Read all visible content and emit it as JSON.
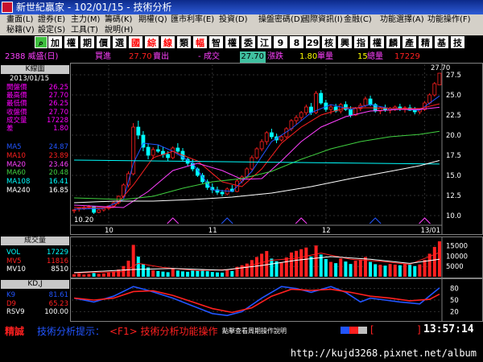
{
  "window": {
    "title": "新世紀贏家 - 102/01/15 - 技術分析"
  },
  "menu": {
    "row1": [
      "畫面(L)",
      "證券(E)",
      "主力(M)",
      "籌碼(K)",
      "期權(Q)",
      "匯市利率(E)",
      "投資(D)",
      "操盤密碼(D)",
      "國際資訊(I)",
      "金融(C)",
      "功能選擇(A)",
      "功能操作(F)"
    ],
    "row2": [
      "秘籍(V)",
      "設定(S)",
      "工具(T)",
      "說明(H)"
    ]
  },
  "toolbar": {
    "buttons": [
      {
        "label": "⌕",
        "icon": "search-icon",
        "fg": "#000000",
        "bg": "#40c040"
      },
      {
        "label": "加",
        "fg": "#000000",
        "bg": "#ffffff"
      },
      {
        "label": "權",
        "fg": "#000000",
        "bg": "#ffffff"
      },
      {
        "label": "期",
        "fg": "#000000",
        "bg": "#ffffff"
      },
      {
        "label": "價",
        "fg": "#000000",
        "bg": "#ffffff"
      },
      {
        "label": "選",
        "fg": "#000000",
        "bg": "#ffffff"
      },
      {
        "label": "國",
        "fg": "#ff0000",
        "bg": "#ffffff"
      },
      {
        "label": "綜",
        "fg": "#ff0000",
        "bg": "#ffffff"
      },
      {
        "label": "線",
        "fg": "#ff0000",
        "bg": "#ffffff"
      },
      {
        "label": "類",
        "fg": "#000000",
        "bg": "#ffffff"
      },
      {
        "label": "幅",
        "fg": "#ff0000",
        "bg": "#ffffff"
      },
      {
        "label": "智",
        "fg": "#000000",
        "bg": "#ffffff"
      },
      {
        "label": "權",
        "fg": "#000000",
        "bg": "#ffffff"
      },
      {
        "label": "委",
        "fg": "#000000",
        "bg": "#ffffff"
      },
      {
        "label": "江",
        "fg": "#000000",
        "bg": "#ffffff"
      },
      {
        "label": "9",
        "fg": "#000000",
        "bg": "#ffffff"
      },
      {
        "label": "8",
        "fg": "#000000",
        "bg": "#ffffff"
      },
      {
        "label": "29",
        "fg": "#000000",
        "bg": "#ffffff"
      },
      {
        "label": "核",
        "fg": "#000000",
        "bg": "#ffffff"
      },
      {
        "label": "興",
        "fg": "#000000",
        "bg": "#ffffff"
      },
      {
        "label": "指",
        "fg": "#000000",
        "bg": "#ffffff"
      },
      {
        "label": "權",
        "fg": "#000000",
        "bg": "#ffffff"
      },
      {
        "label": "麟",
        "fg": "#000000",
        "bg": "#ffffff"
      },
      {
        "label": "產",
        "fg": "#000000",
        "bg": "#ffffff"
      },
      {
        "label": "精",
        "fg": "#000000",
        "bg": "#ffffff"
      },
      {
        "label": "基",
        "fg": "#000000",
        "bg": "#ffffff"
      },
      {
        "label": "技",
        "fg": "#000000",
        "bg": "#ffffff"
      }
    ]
  },
  "quote": {
    "symbol": "2388 威盛(日)",
    "bid_label": "買進",
    "bid": "27.70",
    "ask_label": "賣出",
    "change": "-",
    "trade_label": "成交",
    "trade_price": "27.70",
    "change_label": "漲跌",
    "tick_volume": "1.80",
    "tick_label": "單量",
    "total_tick": "15",
    "total_label": "總量",
    "total_volume": "17229"
  },
  "kline_panel": {
    "title": "K線圖",
    "date": "2013/01/15",
    "fields": [
      {
        "label": "開盤價",
        "value": "26.25",
        "color": "#ff00ff"
      },
      {
        "label": "最高價",
        "value": "27.70",
        "color": "#ff00ff"
      },
      {
        "label": "最低價",
        "value": "26.25",
        "color": "#ff00ff"
      },
      {
        "label": "收盤價",
        "value": "27.70",
        "color": "#ff00ff"
      },
      {
        "label": "成交量",
        "value": "17228",
        "color": "#ff00ff"
      },
      {
        "label": "差",
        "value": "1.80",
        "color": "#ff00ff"
      }
    ],
    "ma": [
      {
        "label": "MA5",
        "value": "24.87",
        "color": "#2255ff"
      },
      {
        "label": "MA10",
        "value": "23.89",
        "color": "#ff2020"
      },
      {
        "label": "MA20",
        "value": "23.46",
        "color": "#ff40ff"
      },
      {
        "label": "MA60",
        "value": "20.48",
        "color": "#40d040"
      },
      {
        "label": "MA108",
        "value": "16.41",
        "color": "#00ffff"
      },
      {
        "label": "MA240",
        "value": "16.85",
        "color": "#ffffff"
      }
    ]
  },
  "volume_panel": {
    "title": "成交量",
    "fields": [
      {
        "label": "VOL",
        "value": "17229",
        "color": "#00ffff"
      },
      {
        "label": "MV5",
        "value": "11816",
        "color": "#ff2020"
      },
      {
        "label": "MV10",
        "value": "8510",
        "color": "#ffffff"
      }
    ]
  },
  "kd_panel": {
    "title": "KD,J",
    "fields": [
      {
        "label": "K9",
        "value": "81.61",
        "color": "#2255ff"
      },
      {
        "label": "D9",
        "value": "65.23",
        "color": "#ff2020"
      },
      {
        "label": "RSV9",
        "value": "100.00",
        "color": "#ffffff"
      }
    ]
  },
  "bottom": {
    "mode": "精誠",
    "hint_label": "技術分析提示：",
    "hint_text": "<F1> 技術分析功能操作",
    "hint_overlay": "點擊查看周期操作說明",
    "bracket": "[",
    "bracket_close": "]",
    "time": "13:57:14"
  },
  "watermark": "http://kujd3268.pixnet.net/album",
  "colors": {
    "up": "#ff2020",
    "down": "#00ffff",
    "grid": "#404040"
  },
  "chart_data": {
    "type": "candlestick",
    "price_axis": {
      "ticks": [
        10.0,
        12.5,
        15.0,
        17.5,
        20.0,
        22.5,
        25.0,
        27.5
      ],
      "ylim": [
        9,
        28.8
      ]
    },
    "x_labels": [
      "10",
      "11",
      "12",
      "13/01"
    ],
    "annotations": {
      "high": "27.70",
      "low": "10.20"
    },
    "candles": [
      [
        10.6,
        10.8,
        10.3,
        10.7
      ],
      [
        10.8,
        11.0,
        10.5,
        10.9
      ],
      [
        10.9,
        11.2,
        10.7,
        11.0
      ],
      [
        11.0,
        11.3,
        10.8,
        11.1
      ],
      [
        11.1,
        11.2,
        10.2,
        10.4
      ],
      [
        10.4,
        10.8,
        10.3,
        10.7
      ],
      [
        10.7,
        11.0,
        10.5,
        10.9
      ],
      [
        10.9,
        11.3,
        10.7,
        11.2
      ],
      [
        11.2,
        11.8,
        11.0,
        11.6
      ],
      [
        11.6,
        12.5,
        11.4,
        12.4
      ],
      [
        12.4,
        14.0,
        12.2,
        13.8
      ],
      [
        13.8,
        15.5,
        13.5,
        15.2
      ],
      [
        15.2,
        21.5,
        15.0,
        21.0
      ],
      [
        21.0,
        21.8,
        19.5,
        20.0
      ],
      [
        20.0,
        20.5,
        18.0,
        18.5
      ],
      [
        18.5,
        19.0,
        17.0,
        17.5
      ],
      [
        17.5,
        18.5,
        17.0,
        18.2
      ],
      [
        18.2,
        18.8,
        17.8,
        18.0
      ],
      [
        18.0,
        18.5,
        17.2,
        17.6
      ],
      [
        17.6,
        18.0,
        16.8,
        17.2
      ],
      [
        17.2,
        18.6,
        17.0,
        18.4
      ],
      [
        18.4,
        19.0,
        17.8,
        18.0
      ],
      [
        18.0,
        18.4,
        16.8,
        17.0
      ],
      [
        17.0,
        17.2,
        16.2,
        16.5
      ],
      [
        16.5,
        17.0,
        15.5,
        15.8
      ],
      [
        15.8,
        16.0,
        14.8,
        15.0
      ],
      [
        15.0,
        15.3,
        14.0,
        14.2
      ],
      [
        14.2,
        14.5,
        13.2,
        13.5
      ],
      [
        13.5,
        14.0,
        12.8,
        13.2
      ],
      [
        13.2,
        13.6,
        12.6,
        12.9
      ],
      [
        12.9,
        13.2,
        12.4,
        12.7
      ],
      [
        12.7,
        13.5,
        12.5,
        13.3
      ],
      [
        13.3,
        13.8,
        12.9,
        13.0
      ],
      [
        13.0,
        14.5,
        12.9,
        14.3
      ],
      [
        14.3,
        15.0,
        14.0,
        14.8
      ],
      [
        14.8,
        16.0,
        14.5,
        15.8
      ],
      [
        15.8,
        17.5,
        15.6,
        17.2
      ],
      [
        17.2,
        18.5,
        17.0,
        18.3
      ],
      [
        18.3,
        19.5,
        18.0,
        19.2
      ],
      [
        19.2,
        20.5,
        18.8,
        20.3
      ],
      [
        20.3,
        20.8,
        19.5,
        19.8
      ],
      [
        19.8,
        20.2,
        19.0,
        19.4
      ],
      [
        19.4,
        20.0,
        19.2,
        19.8
      ],
      [
        19.8,
        21.0,
        19.6,
        20.8
      ],
      [
        20.8,
        22.0,
        20.5,
        21.8
      ],
      [
        21.8,
        22.5,
        21.3,
        22.2
      ],
      [
        22.2,
        23.0,
        21.8,
        22.8
      ],
      [
        22.8,
        23.8,
        22.5,
        23.5
      ],
      [
        23.5,
        24.0,
        22.5,
        22.8
      ],
      [
        22.8,
        25.5,
        22.6,
        25.2
      ],
      [
        25.2,
        25.6,
        23.8,
        24.0
      ],
      [
        24.0,
        24.4,
        22.9,
        23.2
      ],
      [
        23.2,
        23.8,
        22.6,
        23.5
      ],
      [
        23.5,
        23.9,
        22.8,
        23.0
      ],
      [
        23.0,
        24.0,
        22.7,
        23.8
      ],
      [
        23.8,
        24.2,
        23.0,
        23.2
      ],
      [
        23.2,
        23.6,
        22.2,
        22.5
      ],
      [
        22.5,
        23.5,
        22.4,
        23.3
      ],
      [
        23.3,
        24.0,
        23.0,
        23.7
      ],
      [
        23.7,
        24.8,
        23.5,
        24.5
      ],
      [
        24.5,
        24.9,
        23.6,
        23.8
      ],
      [
        23.8,
        24.0,
        22.8,
        23.0
      ],
      [
        23.0,
        23.6,
        22.6,
        23.4
      ],
      [
        23.4,
        23.8,
        22.9,
        23.1
      ],
      [
        23.1,
        23.5,
        22.7,
        23.3
      ],
      [
        23.3,
        23.7,
        23.0,
        23.5
      ],
      [
        23.5,
        23.9,
        23.0,
        23.2
      ],
      [
        23.2,
        23.6,
        22.8,
        23.4
      ],
      [
        23.4,
        23.8,
        23.0,
        23.1
      ],
      [
        23.1,
        23.5,
        22.6,
        22.9
      ],
      [
        22.9,
        23.3,
        22.6,
        23.2
      ],
      [
        23.2,
        24.2,
        23.0,
        24.0
      ],
      [
        24.0,
        25.2,
        23.8,
        25.0
      ],
      [
        25.0,
        26.6,
        24.8,
        26.4
      ],
      [
        26.25,
        27.7,
        26.25,
        27.7
      ]
    ],
    "ma_series": {
      "MA5": [
        [
          0,
          10.8
        ],
        [
          6,
          10.9
        ],
        [
          10,
          12.0
        ],
        [
          12,
          16.5
        ],
        [
          14,
          19.0
        ],
        [
          17,
          18.8
        ],
        [
          20,
          18.0
        ],
        [
          24,
          16.5
        ],
        [
          28,
          13.2
        ],
        [
          32,
          13.0
        ],
        [
          36,
          15.5
        ],
        [
          40,
          19.2
        ],
        [
          44,
          20.8
        ],
        [
          48,
          22.8
        ],
        [
          52,
          23.8
        ],
        [
          56,
          23.2
        ],
        [
          60,
          23.8
        ],
        [
          64,
          23.3
        ],
        [
          70,
          23.1
        ],
        [
          74,
          24.87
        ]
      ],
      "MA10": [
        [
          0,
          11.0
        ],
        [
          8,
          11.0
        ],
        [
          12,
          13.8
        ],
        [
          16,
          17.2
        ],
        [
          20,
          18.0
        ],
        [
          25,
          16.8
        ],
        [
          30,
          14.2
        ],
        [
          34,
          13.6
        ],
        [
          38,
          15.8
        ],
        [
          42,
          19.0
        ],
        [
          46,
          21.0
        ],
        [
          50,
          22.5
        ],
        [
          55,
          23.4
        ],
        [
          60,
          23.4
        ],
        [
          66,
          23.3
        ],
        [
          70,
          23.3
        ],
        [
          74,
          23.89
        ]
      ],
      "MA20": [
        [
          0,
          11.3
        ],
        [
          10,
          11.0
        ],
        [
          15,
          13.0
        ],
        [
          20,
          15.6
        ],
        [
          25,
          16.5
        ],
        [
          30,
          15.6
        ],
        [
          34,
          14.5
        ],
        [
          38,
          14.6
        ],
        [
          42,
          16.8
        ],
        [
          46,
          19.2
        ],
        [
          50,
          21.0
        ],
        [
          55,
          22.3
        ],
        [
          60,
          23.0
        ],
        [
          66,
          23.2
        ],
        [
          70,
          23.2
        ],
        [
          74,
          23.46
        ]
      ],
      "MA60": [
        [
          0,
          12.2
        ],
        [
          10,
          12.0
        ],
        [
          16,
          12.4
        ],
        [
          22,
          13.4
        ],
        [
          28,
          14.2
        ],
        [
          34,
          14.6
        ],
        [
          40,
          15.5
        ],
        [
          46,
          17.0
        ],
        [
          52,
          18.3
        ],
        [
          58,
          19.2
        ],
        [
          64,
          19.8
        ],
        [
          70,
          20.1
        ],
        [
          74,
          20.48
        ]
      ],
      "MA108": [
        [
          0,
          16.9
        ],
        [
          74,
          16.41
        ]
      ],
      "MA240": [
        [
          0,
          11.6
        ],
        [
          8,
          11.8
        ],
        [
          16,
          11.8
        ],
        [
          24,
          12.0
        ],
        [
          32,
          12.3
        ],
        [
          40,
          12.8
        ],
        [
          48,
          13.6
        ],
        [
          56,
          14.6
        ],
        [
          64,
          15.5
        ],
        [
          70,
          16.2
        ],
        [
          74,
          16.85
        ]
      ]
    },
    "volume_axis": {
      "ticks": [
        5000,
        10000,
        15000
      ],
      "ylim": [
        0,
        18000
      ]
    },
    "ma_volume": {
      "MV5": [
        [
          0,
          1800
        ],
        [
          10,
          2500
        ],
        [
          13,
          6500
        ],
        [
          18,
          4500
        ],
        [
          25,
          3000
        ],
        [
          32,
          3500
        ],
        [
          40,
          8000
        ],
        [
          45,
          9000
        ],
        [
          50,
          11500
        ],
        [
          56,
          8500
        ],
        [
          62,
          7500
        ],
        [
          68,
          6000
        ],
        [
          74,
          11816
        ]
      ],
      "MV10": [
        [
          0,
          2000
        ],
        [
          12,
          3500
        ],
        [
          20,
          4000
        ],
        [
          30,
          3200
        ],
        [
          38,
          5500
        ],
        [
          45,
          8000
        ],
        [
          52,
          9800
        ],
        [
          60,
          8500
        ],
        [
          68,
          6500
        ],
        [
          74,
          8510
        ]
      ]
    },
    "kd_axis": {
      "ticks": [
        20,
        50,
        80
      ],
      "ylim": [
        0,
        100
      ]
    },
    "kd_series": {
      "K9": [
        [
          0,
          55
        ],
        [
          4,
          45
        ],
        [
          8,
          60
        ],
        [
          12,
          85
        ],
        [
          15,
          75
        ],
        [
          20,
          55
        ],
        [
          24,
          35
        ],
        [
          28,
          15
        ],
        [
          31,
          10
        ],
        [
          34,
          20
        ],
        [
          38,
          55
        ],
        [
          42,
          85
        ],
        [
          45,
          80
        ],
        [
          48,
          70
        ],
        [
          52,
          85
        ],
        [
          55,
          70
        ],
        [
          58,
          45
        ],
        [
          60,
          55
        ],
        [
          63,
          50
        ],
        [
          66,
          45
        ],
        [
          70,
          40
        ],
        [
          74,
          81.61
        ]
      ],
      "D9": [
        [
          0,
          55
        ],
        [
          4,
          50
        ],
        [
          8,
          55
        ],
        [
          12,
          72
        ],
        [
          16,
          74
        ],
        [
          20,
          62
        ],
        [
          24,
          45
        ],
        [
          28,
          28
        ],
        [
          32,
          18
        ],
        [
          36,
          30
        ],
        [
          40,
          60
        ],
        [
          44,
          78
        ],
        [
          48,
          75
        ],
        [
          52,
          78
        ],
        [
          56,
          70
        ],
        [
          60,
          60
        ],
        [
          64,
          55
        ],
        [
          68,
          48
        ],
        [
          72,
          52
        ],
        [
          74,
          65.23
        ]
      ]
    }
  }
}
